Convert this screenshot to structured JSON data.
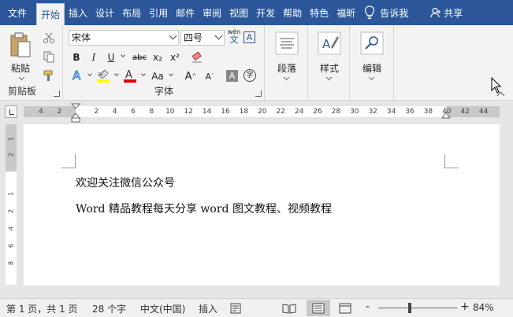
{
  "tabs": {
    "file": "文件",
    "home": "开始",
    "insert": "插入",
    "design": "设计",
    "layout": "布局",
    "references": "引用",
    "mailings": "邮件",
    "review": "审阅",
    "view": "视图",
    "developer": "开发",
    "help": "帮助",
    "special": "特色",
    "foxit": "福昕",
    "tell_me": "告诉我",
    "share": "共享"
  },
  "ribbon": {
    "paste_label": "粘贴",
    "clipboard_label": "剪贴板",
    "font_name": "宋体",
    "font_size": "四号",
    "font_group_label": "字体",
    "bold": "B",
    "italic": "I",
    "underline": "U",
    "strikethrough": "abc",
    "subscript": "x₂",
    "superscript": "x²",
    "font_size_change": "Aa",
    "grow": "A",
    "shrink": "A",
    "char_border": "A",
    "enclose": "字",
    "phonetic_top": "wén",
    "phonetic_char": "文",
    "paragraph_label": "段落",
    "styles_label": "样式",
    "editing_label": "编辑"
  },
  "ruler_ticks": [
    "4",
    "2",
    "",
    "2",
    "4",
    "6",
    "8",
    "10",
    "12",
    "14",
    "16",
    "18",
    "20",
    "22",
    "24",
    "26",
    "28",
    "30",
    "32",
    "34",
    "36",
    "38",
    "40",
    "42",
    "44"
  ],
  "vruler_ticks": [
    "1",
    "2",
    "1",
    "2",
    "4",
    "6",
    "8"
  ],
  "document": {
    "line1": "欢迎关注微信公众号",
    "line2": "Word 精品教程每天分享 word 图文教程、视频教程"
  },
  "status": {
    "page": "第 1 页，共 1 页",
    "words": "28 个字",
    "language": "中文(中国)",
    "mode": "插入",
    "zoom": "84%",
    "zoom_minus": "-",
    "zoom_plus": "+"
  },
  "colors": {
    "tab_bg": "#2b579a",
    "highlight": "#ffff00",
    "font_color": "#e00000"
  }
}
